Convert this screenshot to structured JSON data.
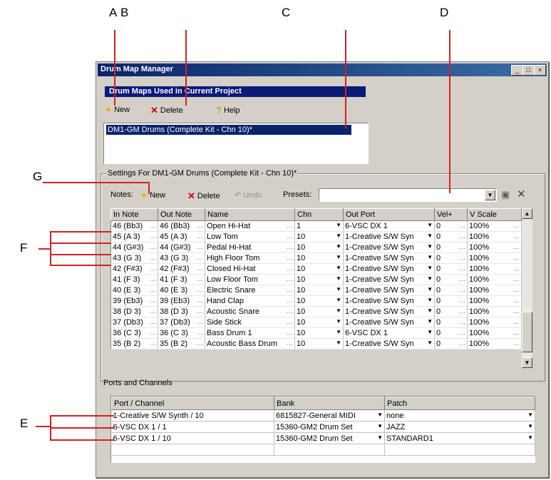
{
  "callouts": {
    "a": "A",
    "b": "B",
    "c": "C",
    "d": "D",
    "e": "E",
    "f": "F",
    "g": "G"
  },
  "window": {
    "title": "Drum Map Manager",
    "minimize": "_",
    "maximize": "□",
    "close": "×"
  },
  "maps_section": {
    "title": "Drum Maps Used in Current Project",
    "new_label": "New",
    "delete_label": "Delete",
    "help_label": "Help",
    "selected_map": "DM1-GM Drums (Complete Kit - Chn 10)*"
  },
  "settings": {
    "title": "Settings For DM1-GM Drums (Complete Kit - Chn 10)*",
    "notes_label": "Notes:",
    "new_label": "New",
    "delete_label": "Delete",
    "undo_label": "Undo",
    "presets_label": "Presets:",
    "presets_value": ""
  },
  "notes_table": {
    "columns": [
      "In Note",
      "Out Note",
      "Name",
      "Chn",
      "Out Port",
      "Vel+",
      "V Scale"
    ],
    "rows": [
      [
        "46 (Bb3)",
        "46 (Bb3)",
        "Open Hi-Hat",
        "1",
        "6-VSC DX 1",
        "0",
        "100%"
      ],
      [
        "45 (A 3)",
        "45 (A 3)",
        "Low Tom",
        "10",
        "1-Creative S/W Syn",
        "0",
        "100%"
      ],
      [
        "44 (G#3)",
        "44 (G#3)",
        "Pedal Hi-Hat",
        "10",
        "1-Creative S/W Syn",
        "0",
        "100%"
      ],
      [
        "43 (G 3)",
        "43 (G 3)",
        "High Floor Tom",
        "10",
        "1-Creative S/W Syn",
        "0",
        "100%"
      ],
      [
        "42 (F#3)",
        "42 (F#3)",
        "Closed Hi-Hat",
        "10",
        "1-Creative S/W Syn",
        "0",
        "100%"
      ],
      [
        "41 (F 3)",
        "41 (F 3)",
        "Low Floor Tom",
        "10",
        "1-Creative S/W Syn",
        "0",
        "100%"
      ],
      [
        "40 (E 3)",
        "40 (E 3)",
        "Electric Snare",
        "10",
        "1-Creative S/W Syn",
        "0",
        "100%"
      ],
      [
        "39 (Eb3)",
        "39 (Eb3)",
        "Hand Clap",
        "10",
        "1-Creative S/W Syn",
        "0",
        "100%"
      ],
      [
        "38 (D 3)",
        "38 (D 3)",
        "Acoustic Snare",
        "10",
        "1-Creative S/W Syn",
        "0",
        "100%"
      ],
      [
        "37 (Db3)",
        "37 (Db3)",
        "Side Stick",
        "10",
        "1-Creative S/W Syn",
        "0",
        "100%"
      ],
      [
        "36 (C 3)",
        "36 (C 3)",
        "Bass Drum 1",
        "10",
        "6-VSC DX 1",
        "0",
        "100%"
      ],
      [
        "35 (B 2)",
        "35 (B 2)",
        "Acoustic Bass Drum",
        "10",
        "1-Creative S/W Syn",
        "0",
        "100%"
      ]
    ]
  },
  "ports_section": {
    "title": "Ports and Channels",
    "columns": [
      "Port / Channel",
      "Bank",
      "Patch"
    ],
    "rows": [
      [
        "1-Creative S/W Synth / 10",
        "6815827-General MIDI",
        "none"
      ],
      [
        "6-VSC DX 1 / 1",
        "15360-GM2 Drum Set",
        "JAZZ"
      ],
      [
        "6-VSC DX 1 / 10",
        "15360-GM2 Drum Set",
        "STANDARD1"
      ]
    ]
  },
  "colors": {
    "annotation_lines": "#d62020",
    "title_bar": "#0a246a",
    "selection": "#0a246a"
  }
}
